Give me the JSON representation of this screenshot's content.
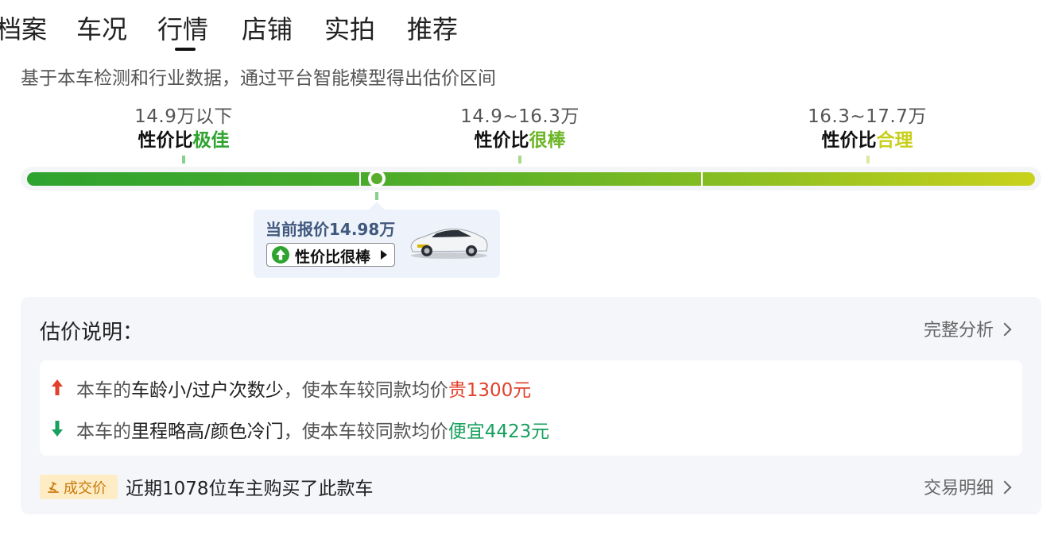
{
  "tabs": [
    "档案",
    "车况",
    "行情",
    "店铺",
    "实拍",
    "推荐"
  ],
  "subtitle": "基于本车检测和行业数据，通过平台智能模型得出估价区间",
  "ranges": [
    {
      "price": "14.9万以下",
      "label_prefix": "性价比",
      "label_value": "极佳",
      "color": "#2ea32f"
    },
    {
      "price": "14.9~16.3万",
      "label_prefix": "性价比",
      "label_value": "很棒",
      "color": "#6cb526"
    },
    {
      "price": "16.3~17.7万",
      "label_prefix": "性价比",
      "label_value": "合理",
      "color": "#c8cf1a"
    }
  ],
  "current": {
    "price_text": "当前报价14.98万",
    "rating": "性价比很棒",
    "icon": "car-image",
    "position_ratio": 0.345
  },
  "explain": {
    "title": "估价说明：",
    "full_analysis": "完整分析",
    "reasons": [
      {
        "prefix": "本车的",
        "factor": "车龄小/过户次数少",
        "middle": "，使本车较同款均价",
        "effect": "贵1300元",
        "direction": "up",
        "color": "#e0412a"
      },
      {
        "prefix": "本车的",
        "factor": "里程略高/颜色冷门",
        "middle": "，使本车较同款均价",
        "effect": "便宜4423元",
        "direction": "down",
        "color": "#17a05e"
      }
    ],
    "deal_tag": "成交价",
    "deal_text": "近期1078位车主购买了此款车",
    "deal_link": "交易明细"
  }
}
